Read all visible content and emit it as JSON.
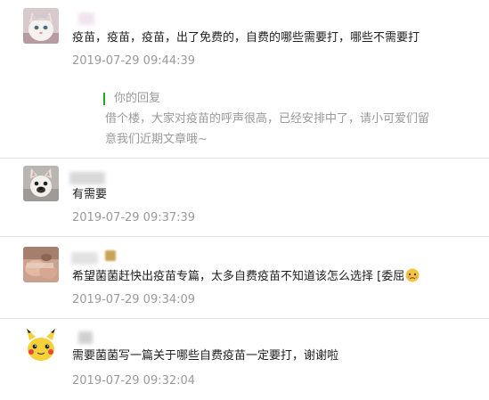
{
  "comments": [
    {
      "text": "疫苗，疫苗，疫苗，出了免费的，自费的哪些需要打，哪些不需要打",
      "time": "2019-07-29 09:44:39",
      "avatar": "cat-avatar-icon",
      "reply": {
        "label": "你的回复",
        "line1": "借个楼，大家对疫苗的呼声很高，已经安排中了，请小可爱们留",
        "line2": "意我们近期文章哦~"
      }
    },
    {
      "text": "有需要",
      "time": "2019-07-29 09:37:39",
      "avatar": "bulldog-avatar-icon"
    },
    {
      "text": "希望菌菌赶快出疫苗专篇，太多自费疫苗不知道该怎么选择 [委屈",
      "time": "2019-07-29 09:34:09",
      "avatar": "photo-avatar-icon",
      "emoji": "aggrieved-emoji-icon"
    },
    {
      "text": "需要菌菌写一篇关于哪些自费疫苗一定要打，谢谢啦",
      "time": "2019-07-29 09:32:04",
      "avatar": "pikachu-avatar-icon"
    }
  ],
  "colors": {
    "reply_bar": "#1aad19",
    "timestamp": "#9a9a9a",
    "divider": "#e6e6e6"
  }
}
